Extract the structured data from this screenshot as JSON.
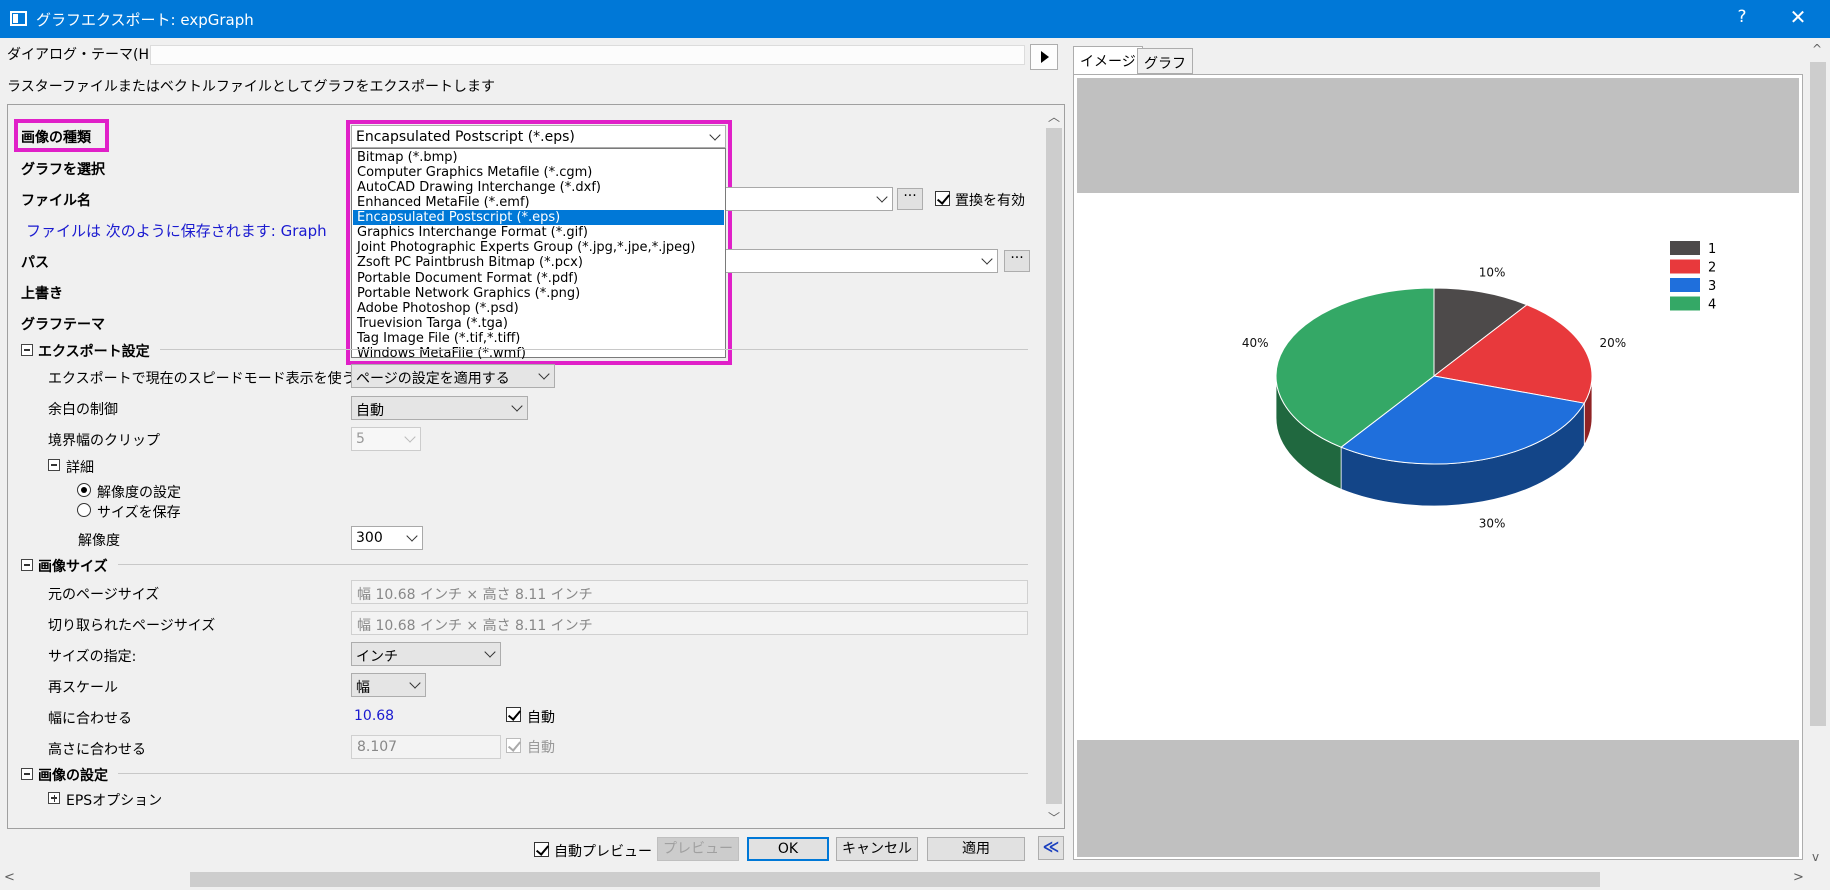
{
  "window": {
    "title": "グラフエクスポート: expGraph",
    "help": "?",
    "close": "✕"
  },
  "dialog_theme": {
    "label": "ダイアログ・テーマ(H)",
    "value": ""
  },
  "description": "ラスターファイルまたはベクトルファイルとしてグラフをエクスポートします",
  "properties": {
    "image_type": {
      "label": "画像の種類",
      "value": "Encapsulated Postscript (*.eps)"
    },
    "select_graph": {
      "label": "グラフを選択"
    },
    "file_name": {
      "label": "ファイル名",
      "saved_as": "ファイルは 次のように保存されます: Graph",
      "replace_label": "置換を有効",
      "replace_checked": true
    },
    "path": {
      "label": "パス"
    },
    "overwrite": {
      "label": "上書き"
    },
    "graph_theme": {
      "label": "グラフテーマ"
    }
  },
  "dropdown_options": [
    "Bitmap (*.bmp)",
    "Computer Graphics Metafile (*.cgm)",
    "AutoCAD Drawing Interchange (*.dxf)",
    "Enhanced MetaFile (*.emf)",
    "Encapsulated Postscript (*.eps)",
    "Graphics Interchange Format (*.gif)",
    "Joint Photographic Experts Group (*.jpg,*.jpe,*.jpeg)",
    "Zsoft PC Paintbrush Bitmap (*.pcx)",
    "Portable Document Format (*.pdf)",
    "Portable Network Graphics (*.png)",
    "Adobe Photoshop (*.psd)",
    "Truevision Targa (*.tga)",
    "Tag Image File (*.tif,*.tiff)",
    "Windows MetaFile (*.wmf)"
  ],
  "dropdown_selected_index": 4,
  "export_settings": {
    "header": "エクスポート設定",
    "speed_mode_label": "エクスポートで現在のスピードモード表示を使う",
    "speed_mode_value": "ページの設定を適用する",
    "margin_label": "余白の制御",
    "margin_value": "自動",
    "clip_label": "境界幅のクリップ",
    "clip_value": "5",
    "details_header": "詳細",
    "radio_resolution": "解像度の設定",
    "radio_keep_size": "サイズを保存",
    "resolution_label": "解像度",
    "resolution_value": "300"
  },
  "image_size": {
    "header": "画像サイズ",
    "orig_page_label": "元のページサイズ",
    "orig_page_value": "幅 10.68 インチ × 高さ 8.11 インチ",
    "cropped_page_label": "切り取られたページサイズ",
    "cropped_page_value": "幅 10.68 インチ × 高さ 8.11 インチ",
    "size_spec_label": "サイズの指定:",
    "size_spec_value": "インチ",
    "rescale_label": "再スケール",
    "rescale_value": "幅",
    "fit_width_label": "幅に合わせる",
    "fit_width_value": "10.68",
    "fit_width_auto": "自動",
    "fit_height_label": "高さに合わせる",
    "fit_height_value": "8.107",
    "fit_height_auto": "自動"
  },
  "image_settings": {
    "header": "画像の設定",
    "eps_options": "EPSオプション"
  },
  "buttons": {
    "auto_preview": "自動プレビュー",
    "preview": "プレビュー",
    "ok": "OK",
    "cancel": "キャンセル",
    "apply": "適用",
    "collapse": "≪"
  },
  "tabs": {
    "image": "イメージ",
    "graph": "グラフ"
  },
  "colors": {
    "accent": "#0078d7",
    "highlight": "#e020c8",
    "link_blue": "#1a1ad0"
  },
  "chart_data": {
    "type": "pie",
    "categories": [
      "1",
      "2",
      "3",
      "4"
    ],
    "values": [
      10,
      20,
      30,
      40
    ],
    "labels": [
      "10%",
      "20%",
      "30%",
      "40%"
    ],
    "colors": [
      "#4d4a4a",
      "#e8393c",
      "#1f6fdc",
      "#34a866"
    ],
    "legend_position": "top-right",
    "style": "3d"
  }
}
